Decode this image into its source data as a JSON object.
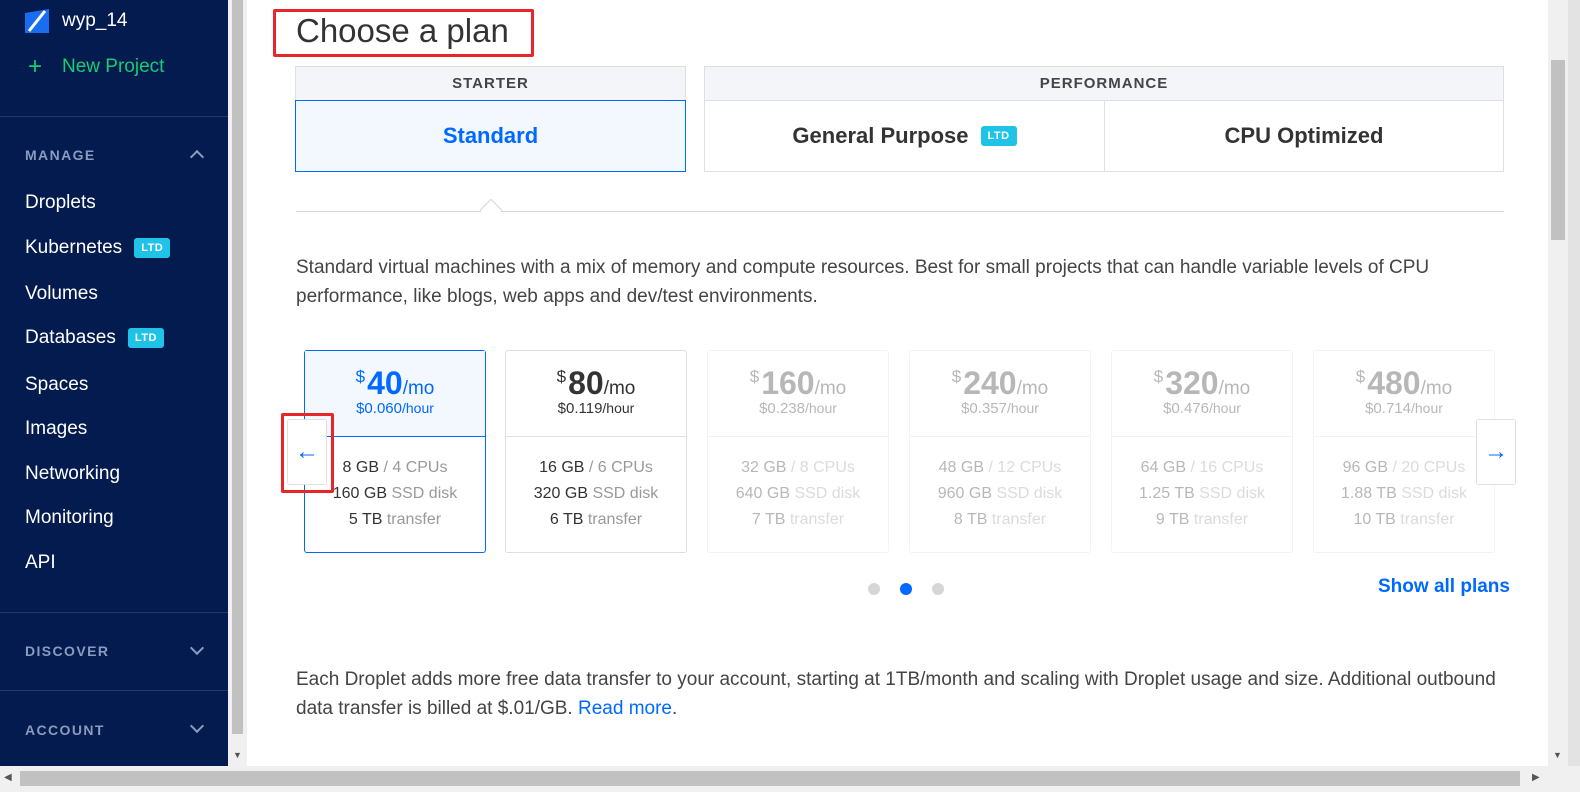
{
  "sidebar": {
    "user": "wyp_14",
    "new_project": "New Project",
    "sections": {
      "manage": "MANAGE",
      "discover": "DISCOVER",
      "account": "ACCOUNT"
    },
    "items": [
      {
        "label": "Droplets",
        "badge": ""
      },
      {
        "label": "Kubernetes",
        "badge": "LTD"
      },
      {
        "label": "Volumes",
        "badge": ""
      },
      {
        "label": "Databases",
        "badge": "LTD"
      },
      {
        "label": "Spaces",
        "badge": ""
      },
      {
        "label": "Images",
        "badge": ""
      },
      {
        "label": "Networking",
        "badge": ""
      },
      {
        "label": "Monitoring",
        "badge": ""
      },
      {
        "label": "API",
        "badge": ""
      }
    ]
  },
  "main": {
    "title": "Choose a plan",
    "groups": {
      "starter": "STARTER",
      "performance": "PERFORMANCE"
    },
    "tabs": {
      "standard": "Standard",
      "general_purpose": "General Purpose",
      "general_badge": "LTD",
      "cpu_optimized": "CPU Optimized"
    },
    "description": "Standard virtual machines with a mix of memory and compute resources. Best for small projects that can handle variable levels of CPU performance, like blogs, web apps and dev/test environments.",
    "plans": [
      {
        "currency": "$",
        "amount": "40",
        "per": "/mo",
        "hourly": "$0.060",
        "hour_unit": "/hour",
        "mem": "8 GB",
        "cpu": "/ 4 CPUs",
        "disk": "160 GB",
        "disk_label": "SSD disk",
        "transfer": "5 TB",
        "transfer_label": "transfer"
      },
      {
        "currency": "$",
        "amount": "80",
        "per": "/mo",
        "hourly": "$0.119",
        "hour_unit": "/hour",
        "mem": "16 GB",
        "cpu": "/ 6 CPUs",
        "disk": "320 GB",
        "disk_label": "SSD disk",
        "transfer": "6 TB",
        "transfer_label": "transfer"
      },
      {
        "currency": "$",
        "amount": "160",
        "per": "/mo",
        "hourly": "$0.238",
        "hour_unit": "/hour",
        "mem": "32 GB",
        "cpu": "/ 8 CPUs",
        "disk": "640 GB",
        "disk_label": "SSD disk",
        "transfer": "7 TB",
        "transfer_label": "transfer"
      },
      {
        "currency": "$",
        "amount": "240",
        "per": "/mo",
        "hourly": "$0.357",
        "hour_unit": "/hour",
        "mem": "48 GB",
        "cpu": "/ 12 CPUs",
        "disk": "960 GB",
        "disk_label": "SSD disk",
        "transfer": "8 TB",
        "transfer_label": "transfer"
      },
      {
        "currency": "$",
        "amount": "320",
        "per": "/mo",
        "hourly": "$0.476",
        "hour_unit": "/hour",
        "mem": "64 GB",
        "cpu": "/ 16 CPUs",
        "disk": "1.25 TB",
        "disk_label": "SSD disk",
        "transfer": "9 TB",
        "transfer_label": "transfer"
      },
      {
        "currency": "$",
        "amount": "480",
        "per": "/mo",
        "hourly": "$0.714",
        "hour_unit": "/hour",
        "mem": "96 GB",
        "cpu": "/ 20 CPUs",
        "disk": "1.88 TB",
        "disk_label": "SSD disk",
        "transfer": "10 TB",
        "transfer_label": "transfer"
      }
    ],
    "show_all": "Show all plans",
    "footer_text": "Each Droplet adds more free data transfer to your account, starting at 1TB/month and scaling with Droplet usage and size. Additional outbound data transfer is billed at $.01/GB.",
    "footer_link": "Read more",
    "footer_end": "."
  },
  "colors": {
    "sidebar_bg": "#031b4e",
    "accent": "#0069ff",
    "new_project": "#15cd72",
    "badge": "#1fc3e7",
    "annotation": "#e8262a"
  }
}
